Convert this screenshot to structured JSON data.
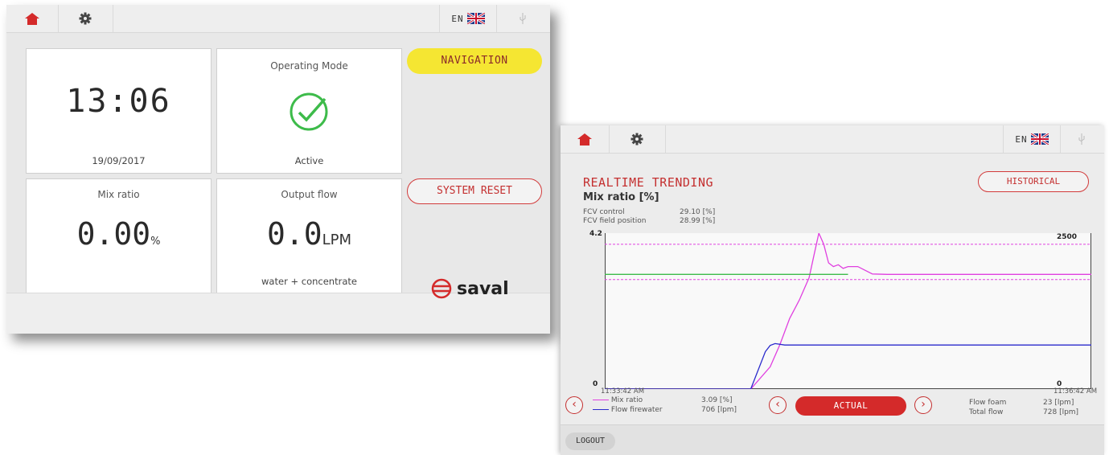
{
  "dashboard": {
    "lang": "EN",
    "time": "13:06",
    "date": "19/09/2017",
    "operating_mode": {
      "title": "Operating Mode",
      "status": "Active"
    },
    "mix_ratio": {
      "title": "Mix ratio",
      "value": "0.00",
      "unit": "%"
    },
    "output_flow": {
      "title": "Output flow",
      "value": "0.0",
      "unit": "LPM",
      "sub": "water + concentrate"
    },
    "navigation_button": "NAVIGATION",
    "system_reset_button": "SYSTEM RESET",
    "logo_text": "saval",
    "colors": {
      "accent_red": "#c43030",
      "yellow": "#f5e632",
      "check_green": "#3dbb4a"
    }
  },
  "trending": {
    "lang": "EN",
    "title": "REALTIME TRENDING",
    "subtitle": "Mix ratio [%]",
    "historical_button": "HISTORICAL",
    "info": [
      {
        "label": "FCV control",
        "value": "29.10",
        "unit": "[%]"
      },
      {
        "label": "FCV field position",
        "value": "28.99",
        "unit": "[%]"
      }
    ],
    "legend_left": [
      {
        "label": "Mix ratio",
        "value": "3.09",
        "unit": "[%]",
        "color": "#e040e0"
      },
      {
        "label": "Flow firewater",
        "value": "706",
        "unit": "[lpm]",
        "color": "#2a2acc"
      }
    ],
    "legend_right": [
      {
        "label": "Flow foam",
        "value": "23",
        "unit": "[lpm]"
      },
      {
        "label": "Total flow",
        "value": "728",
        "unit": "[lpm]"
      }
    ],
    "actual_button": "ACTUAL",
    "logout_button": "LOGOUT",
    "prev_symbol": "‹",
    "next_symbol": "›"
  },
  "chart_data": {
    "type": "line",
    "x_start": "11:33:42 AM",
    "x_end": "11:36:42 AM",
    "y_left": {
      "min": "0",
      "max": "4.2",
      "range": [
        0,
        4.2
      ]
    },
    "y_right": {
      "min": "0",
      "max": "2500",
      "range": [
        0,
        2500
      ]
    },
    "series": [
      {
        "name": "Mix ratio",
        "axis": "left",
        "color": "#e040e0",
        "x": [
          0,
          0.3,
          0.34,
          0.36,
          0.38,
          0.4,
          0.42,
          0.43,
          0.44,
          0.45,
          0.46,
          0.47,
          0.48,
          0.49,
          0.5,
          0.52,
          0.55,
          0.58,
          0.6,
          1.0
        ],
        "y": [
          0,
          0,
          0.6,
          1.2,
          1.9,
          2.4,
          3.0,
          3.6,
          4.2,
          3.9,
          3.4,
          3.3,
          3.35,
          3.25,
          3.3,
          3.3,
          3.1,
          3.09,
          3.09,
          3.09
        ]
      },
      {
        "name": "Flow firewater",
        "axis": "right",
        "color": "#2a2acc",
        "x": [
          0,
          0.3,
          0.33,
          0.34,
          0.35,
          0.37,
          1.0
        ],
        "y": [
          0,
          0,
          600,
          700,
          730,
          706,
          706
        ]
      },
      {
        "color": "#3dbb4a",
        "axis": "left",
        "x": [
          0,
          0.5
        ],
        "y": [
          3.09,
          3.09
        ]
      }
    ],
    "limits": [
      {
        "axis": "left",
        "value": 3.9,
        "style": "dashed",
        "color": "#e040e0"
      },
      {
        "axis": "left",
        "value": 2.95,
        "style": "dashed",
        "color": "#e040e0"
      }
    ]
  }
}
